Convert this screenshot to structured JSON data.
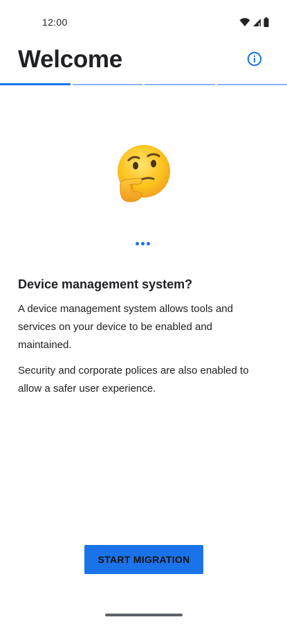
{
  "status_bar": {
    "time": "12:00",
    "icons": [
      "wifi-icon",
      "signal-icon",
      "battery-icon"
    ]
  },
  "header": {
    "title": "Welcome",
    "info_icon": "info-icon"
  },
  "progress": {
    "total_steps": 4,
    "current_step": 1
  },
  "illustration": {
    "icon": "thinking-face-emoji"
  },
  "loading_indicator": {
    "icon": "loading-dots-icon"
  },
  "content": {
    "heading": "Device management system?",
    "paragraph_1": "A device management system allows tools and services on your device to be enabled and maintained.",
    "paragraph_2": "Security and corporate polices are also enabled to allow a safer user experience."
  },
  "actions": {
    "start_label": "START MIGRATION"
  },
  "colors": {
    "accent": "#1a73e8",
    "progress_inactive": "#8ab4f8",
    "text": "#202124"
  }
}
